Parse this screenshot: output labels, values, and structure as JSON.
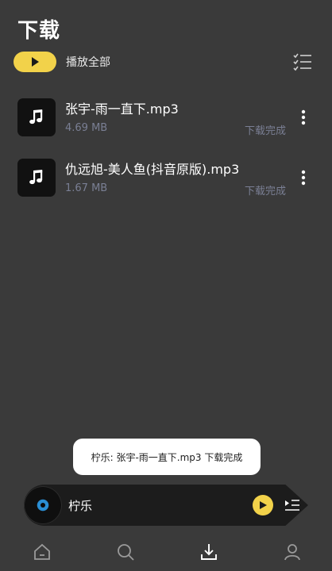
{
  "header": {
    "title": "下载"
  },
  "toolbar": {
    "play_all_label": "播放全部",
    "play_icon": "play-icon",
    "multi_select_icon": "checklist-icon",
    "accent_color": "#f2d24a"
  },
  "downloads": [
    {
      "title": "张宇-雨一直下.mp3",
      "size": "4.69 MB",
      "status": "下载完成",
      "icon": "music-note-icon"
    },
    {
      "title": "仇远旭-美人鱼(抖音原版).mp3",
      "size": "1.67 MB",
      "status": "下载完成",
      "icon": "music-note-icon"
    }
  ],
  "toast": {
    "text": "柠乐: 张宇-雨一直下.mp3 下载完成"
  },
  "player": {
    "title": "柠乐"
  },
  "tabbar": {
    "items": [
      {
        "icon": "home-icon"
      },
      {
        "icon": "search-icon"
      },
      {
        "icon": "download-icon",
        "active": true
      },
      {
        "icon": "profile-icon"
      }
    ]
  }
}
